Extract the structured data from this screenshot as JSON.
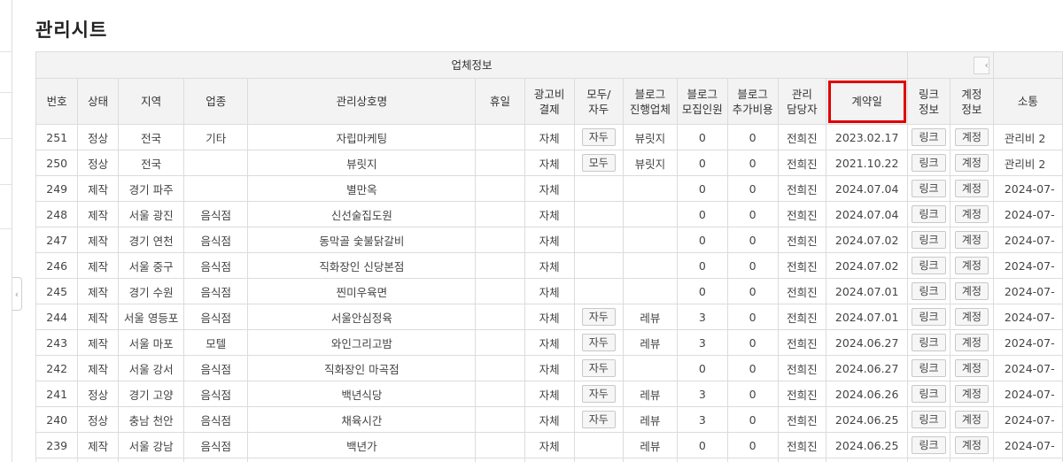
{
  "page_title": "관리시트",
  "header": {
    "group_label": "업체정보",
    "nav_left_glyph": "‹",
    "columns": [
      "번호",
      "상태",
      "지역",
      "업종",
      "관리상호명",
      "휴일",
      "광고비\n결제",
      "모두/\n자두",
      "블로그\n진행업체",
      "블로그\n모집인원",
      "블로그\n추가비용",
      "관리\n담당자",
      "계약일",
      "링크\n정보",
      "계정\n정보",
      "소통"
    ]
  },
  "rows": [
    {
      "no": "251",
      "status": "정상",
      "region": "전국",
      "industry": "기타",
      "name": "자립마케팅",
      "holiday": "",
      "adpay": "자체",
      "modu": "자두",
      "blog_co": "뷰릿지",
      "recruit": "0",
      "extra": "0",
      "manager": "전희진",
      "contract": "2023.02.17",
      "link": "링크",
      "account": "계정",
      "comm": "관리비 2"
    },
    {
      "no": "250",
      "status": "정상",
      "region": "전국",
      "industry": "",
      "name": "뷰릿지",
      "holiday": "",
      "adpay": "자체",
      "modu": "모두",
      "blog_co": "뷰릿지",
      "recruit": "0",
      "extra": "0",
      "manager": "전희진",
      "contract": "2021.10.22",
      "link": "링크",
      "account": "계정",
      "comm": "관리비 2"
    },
    {
      "no": "249",
      "status": "제작",
      "region": "경기 파주",
      "industry": "",
      "name": "별만옥",
      "holiday": "",
      "adpay": "자체",
      "modu": "",
      "blog_co": "",
      "recruit": "0",
      "extra": "0",
      "manager": "전희진",
      "contract": "2024.07.04",
      "link": "링크",
      "account": "계정",
      "comm": "2024-07-"
    },
    {
      "no": "248",
      "status": "제작",
      "region": "서울 광진",
      "industry": "음식점",
      "name": "신선술집도원",
      "holiday": "",
      "adpay": "자체",
      "modu": "",
      "blog_co": "",
      "recruit": "0",
      "extra": "0",
      "manager": "전희진",
      "contract": "2024.07.04",
      "link": "링크",
      "account": "계정",
      "comm": "2024-07-"
    },
    {
      "no": "247",
      "status": "제작",
      "region": "경기 연천",
      "industry": "음식점",
      "name": "동막골 숯불닭갈비",
      "holiday": "",
      "adpay": "자체",
      "modu": "",
      "blog_co": "",
      "recruit": "0",
      "extra": "0",
      "manager": "전희진",
      "contract": "2024.07.02",
      "link": "링크",
      "account": "계정",
      "comm": "2024-07-"
    },
    {
      "no": "246",
      "status": "제작",
      "region": "서울 중구",
      "industry": "음식점",
      "name": "직화장인 신당본점",
      "holiday": "",
      "adpay": "자체",
      "modu": "",
      "blog_co": "",
      "recruit": "0",
      "extra": "0",
      "manager": "전희진",
      "contract": "2024.07.02",
      "link": "링크",
      "account": "계정",
      "comm": "2024-07-"
    },
    {
      "no": "245",
      "status": "제작",
      "region": "경기 수원",
      "industry": "음식점",
      "name": "찐미우육면",
      "holiday": "",
      "adpay": "자체",
      "modu": "",
      "blog_co": "",
      "recruit": "0",
      "extra": "0",
      "manager": "전희진",
      "contract": "2024.07.01",
      "link": "링크",
      "account": "계정",
      "comm": "2024-07-"
    },
    {
      "no": "244",
      "status": "제작",
      "region": "서울 영등포",
      "industry": "음식점",
      "name": "서울안심정육",
      "holiday": "",
      "adpay": "자체",
      "modu": "자두",
      "blog_co": "레뷰",
      "recruit": "3",
      "extra": "0",
      "manager": "전희진",
      "contract": "2024.07.01",
      "link": "링크",
      "account": "계정",
      "comm": "2024-07-"
    },
    {
      "no": "243",
      "status": "제작",
      "region": "서울 마포",
      "industry": "모텔",
      "name": "와인그리고밤",
      "holiday": "",
      "adpay": "자체",
      "modu": "자두",
      "blog_co": "레뷰",
      "recruit": "3",
      "extra": "0",
      "manager": "전희진",
      "contract": "2024.06.27",
      "link": "링크",
      "account": "계정",
      "comm": "2024-07-"
    },
    {
      "no": "242",
      "status": "제작",
      "region": "서울 강서",
      "industry": "음식점",
      "name": "직화장인 마곡점",
      "holiday": "",
      "adpay": "자체",
      "modu": "자두",
      "blog_co": "",
      "recruit": "0",
      "extra": "0",
      "manager": "전희진",
      "contract": "2024.06.27",
      "link": "링크",
      "account": "계정",
      "comm": "2024-07-"
    },
    {
      "no": "241",
      "status": "정상",
      "region": "경기 고양",
      "industry": "음식점",
      "name": "백년식당",
      "holiday": "",
      "adpay": "자체",
      "modu": "자두",
      "blog_co": "레뷰",
      "recruit": "3",
      "extra": "0",
      "manager": "전희진",
      "contract": "2024.06.26",
      "link": "링크",
      "account": "계정",
      "comm": "2024-07-"
    },
    {
      "no": "240",
      "status": "정상",
      "region": "충남 천안",
      "industry": "음식점",
      "name": "채육시간",
      "holiday": "",
      "adpay": "자체",
      "modu": "자두",
      "blog_co": "레뷰",
      "recruit": "3",
      "extra": "0",
      "manager": "전희진",
      "contract": "2024.06.25",
      "link": "링크",
      "account": "계정",
      "comm": "2024-07-"
    },
    {
      "no": "239",
      "status": "제작",
      "region": "서울 강남",
      "industry": "음식점",
      "name": "백년가",
      "holiday": "",
      "adpay": "자체",
      "modu": "",
      "blog_co": "레뷰",
      "recruit": "0",
      "extra": "0",
      "manager": "전희진",
      "contract": "2024.06.25",
      "link": "링크",
      "account": "계정",
      "comm": "2024-07-"
    }
  ],
  "colors": {
    "highlight": "#e00000",
    "header_bg": "#f3f3f3",
    "border": "#dcdcdc"
  }
}
